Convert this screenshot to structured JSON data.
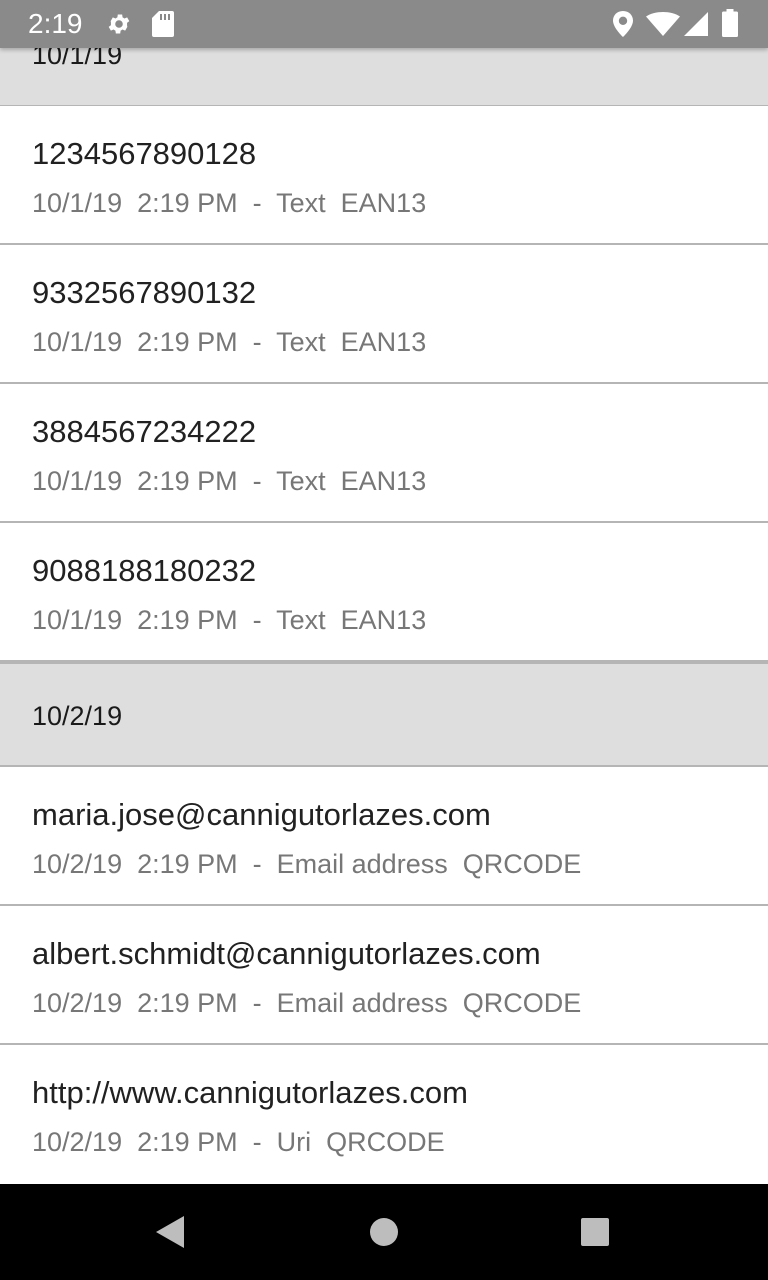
{
  "status_bar": {
    "time": "2:19",
    "icons_left": [
      "gear-icon",
      "sd-card-icon"
    ],
    "icons_right": [
      "location-icon",
      "wifi-icon",
      "signal-icon",
      "battery-icon"
    ]
  },
  "sections": [
    {
      "date": "10/1/19",
      "rows": [
        {
          "value": "1234567890128",
          "details": "10/1/19  2:19 PM  -  Text  EAN13"
        },
        {
          "value": "9332567890132",
          "details": "10/1/19  2:19 PM  -  Text  EAN13"
        },
        {
          "value": "3884567234222",
          "details": "10/1/19  2:19 PM  -  Text  EAN13"
        },
        {
          "value": "9088188180232",
          "details": "10/1/19  2:19 PM  -  Text  EAN13"
        }
      ]
    },
    {
      "date": "10/2/19",
      "rows": [
        {
          "value": "maria.jose@cannigutorlazes.com",
          "details": "10/2/19  2:19 PM  -  Email address  QRCODE"
        },
        {
          "value": "albert.schmidt@cannigutorlazes.com",
          "details": "10/2/19  2:19 PM  -  Email address  QRCODE"
        },
        {
          "value": "http://www.cannigutorlazes.com",
          "details": "10/2/19  2:19 PM  -  Uri  QRCODE"
        }
      ]
    }
  ],
  "nav_bar": {
    "icons": [
      "back-icon",
      "home-icon",
      "recents-icon"
    ]
  },
  "colors": {
    "status_bar": "#8a8a8a",
    "section_header": "#dedede",
    "divider": "#b5b5b5",
    "primary_text": "#212121",
    "secondary_text": "#777777",
    "nav_bar": "#000000"
  }
}
